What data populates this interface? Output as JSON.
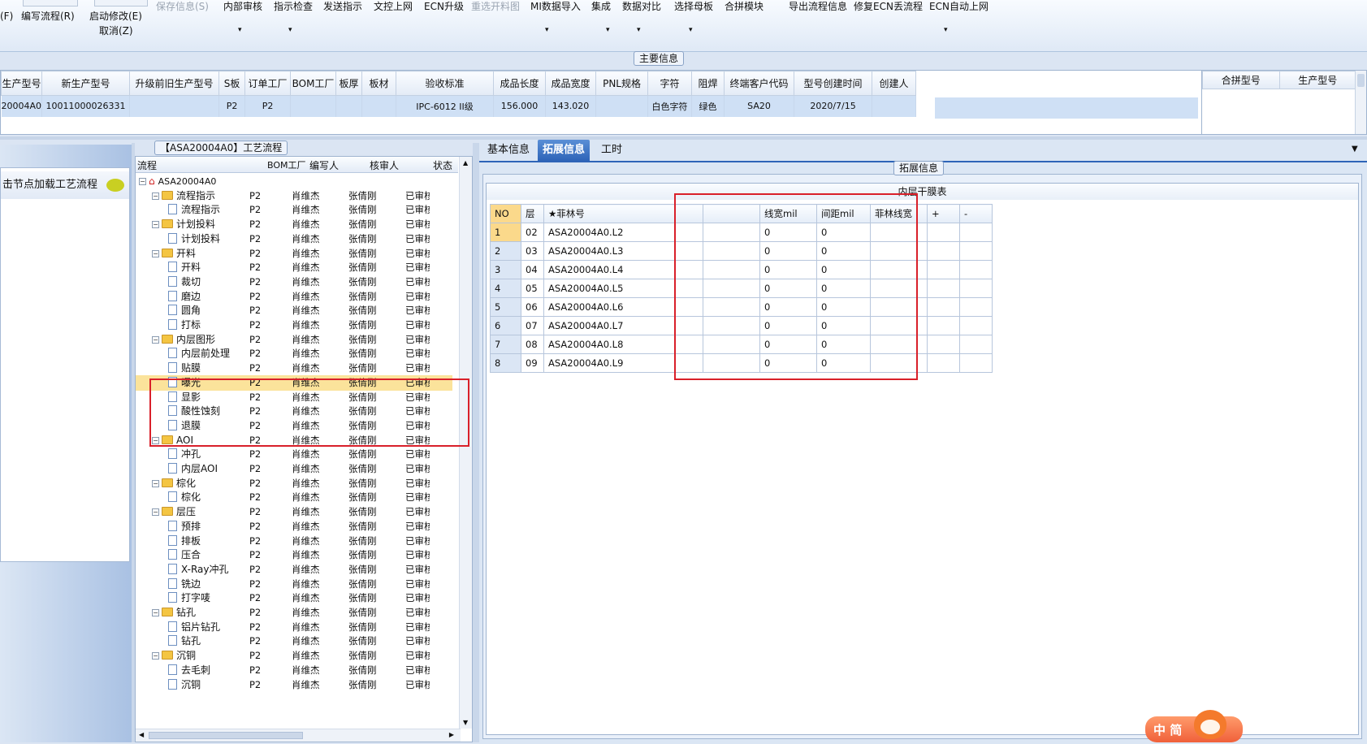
{
  "toolbar": {
    "row1": [
      {
        "label": "保存信息(S)",
        "disabled": true
      },
      {
        "label": "内部审核",
        "dropdown": true
      },
      {
        "label": "指示检查",
        "dropdown": true
      },
      {
        "label": "发送指示"
      },
      {
        "label": "文控上网"
      },
      {
        "label": "ECN升级"
      },
      {
        "label": "重选开料图",
        "disabled": true
      },
      {
        "label": "MI数据导入",
        "dropdown": true
      },
      {
        "label": "集成",
        "dropdown": true
      },
      {
        "label": "数据对比",
        "dropdown": true
      },
      {
        "label": "选择母板",
        "dropdown": true
      },
      {
        "label": "合拼模块"
      },
      {
        "label": "导出流程信息"
      },
      {
        "label": "修复ECN丢流程"
      },
      {
        "label": "ECN自动上网",
        "dropdown": true
      }
    ],
    "left_partial": "(F)",
    "write_flow": "编写流程(R)",
    "auto_modify": "启动修改(E)",
    "cancel": "取消(Z)"
  },
  "main_info": {
    "caption": "主要信息",
    "columns": [
      "生产型号",
      "新生产型号",
      "升级前旧生产型号",
      "S板",
      "订单工厂",
      "BOM工厂",
      "板厚",
      "板材",
      "验收标准",
      "成品长度",
      "成品宽度",
      "PNL规格",
      "字符",
      "阻焊",
      "终端客户代码",
      "型号创建时间",
      "创建人"
    ],
    "row": [
      "20004A0",
      "10011000026331",
      "",
      "P2",
      "P2",
      "",
      "",
      "",
      "IPC-6012 II级",
      "156.000",
      "143.020",
      "",
      "白色字符",
      "绿色",
      "SA20",
      "2020/7/15",
      ""
    ],
    "right_columns": [
      "合拼型号",
      "生产型号"
    ]
  },
  "left_panel": {
    "hint": "击节点加载工艺流程"
  },
  "process": {
    "caption": "【ASA20004A0】工艺流程",
    "headers": [
      "流程",
      "BOM工厂",
      "编写人",
      "核审人",
      "状态"
    ],
    "root": "ASA20004A0",
    "rows": [
      {
        "name": "流程指示",
        "type": "folder"
      },
      {
        "name": "流程指示",
        "type": "doc"
      },
      {
        "name": "计划投料",
        "type": "folder"
      },
      {
        "name": "计划投料",
        "type": "doc"
      },
      {
        "name": "开料",
        "type": "folder"
      },
      {
        "name": "开料",
        "type": "doc"
      },
      {
        "name": "裁切",
        "type": "doc"
      },
      {
        "name": "磨边",
        "type": "doc"
      },
      {
        "name": "圆角",
        "type": "doc"
      },
      {
        "name": "打标",
        "type": "doc"
      },
      {
        "name": "内层图形",
        "type": "folder"
      },
      {
        "name": "内层前处理",
        "type": "doc"
      },
      {
        "name": "贴膜",
        "type": "doc"
      },
      {
        "name": "曝光",
        "type": "doc",
        "selected": true
      },
      {
        "name": "显影",
        "type": "doc"
      },
      {
        "name": "酸性蚀刻",
        "type": "doc"
      },
      {
        "name": "退膜",
        "type": "doc"
      },
      {
        "name": "AOI",
        "type": "folder"
      },
      {
        "name": "冲孔",
        "type": "doc"
      },
      {
        "name": "内层AOI",
        "type": "doc"
      },
      {
        "name": "棕化",
        "type": "folder"
      },
      {
        "name": "棕化",
        "type": "doc"
      },
      {
        "name": "层压",
        "type": "folder"
      },
      {
        "name": "预排",
        "type": "doc"
      },
      {
        "name": "排板",
        "type": "doc"
      },
      {
        "name": "压合",
        "type": "doc"
      },
      {
        "name": "X-Ray冲孔",
        "type": "doc"
      },
      {
        "name": "铣边",
        "type": "doc"
      },
      {
        "name": "打字唛",
        "type": "doc"
      },
      {
        "name": "钻孔",
        "type": "folder"
      },
      {
        "name": "铝片钻孔",
        "type": "doc"
      },
      {
        "name": "钻孔",
        "type": "doc"
      },
      {
        "name": "沉铜",
        "type": "folder"
      },
      {
        "name": "去毛刺",
        "type": "doc"
      },
      {
        "name": "沉铜",
        "type": "doc"
      }
    ],
    "bom": "P2",
    "writer": "肖维杰",
    "reviewer": "张倩刚",
    "status": "已审核"
  },
  "tabs": {
    "items": [
      "基本信息",
      "拓展信息",
      "工时"
    ],
    "active": 1
  },
  "ext": {
    "caption": "拓展信息",
    "table_title": "内层干膜表",
    "headers": [
      "NO",
      "层",
      "★菲林号",
      "",
      "线宽mil",
      "间距mil",
      "菲林线宽",
      "+",
      "-"
    ],
    "rows": [
      [
        "1",
        "02",
        "ASA20004A0.L2",
        "",
        "0",
        "0",
        "",
        "",
        ""
      ],
      [
        "2",
        "03",
        "ASA20004A0.L3",
        "",
        "0",
        "0",
        "",
        "",
        ""
      ],
      [
        "3",
        "04",
        "ASA20004A0.L4",
        "",
        "0",
        "0",
        "",
        "",
        ""
      ],
      [
        "4",
        "05",
        "ASA20004A0.L5",
        "",
        "0",
        "0",
        "",
        "",
        ""
      ],
      [
        "5",
        "06",
        "ASA20004A0.L6",
        "",
        "0",
        "0",
        "",
        "",
        ""
      ],
      [
        "6",
        "07",
        "ASA20004A0.L7",
        "",
        "0",
        "0",
        "",
        "",
        ""
      ],
      [
        "7",
        "08",
        "ASA20004A0.L8",
        "",
        "0",
        "0",
        "",
        "",
        ""
      ],
      [
        "8",
        "09",
        "ASA20004A0.L9",
        "",
        "0",
        "0",
        "",
        "",
        ""
      ]
    ]
  },
  "ime": {
    "label": "中 简"
  },
  "colors": {
    "accent": "#2e64b8",
    "highlight": "#d9202a",
    "selected_row": "#fbe39b",
    "header_row": "#cfe0f5"
  }
}
